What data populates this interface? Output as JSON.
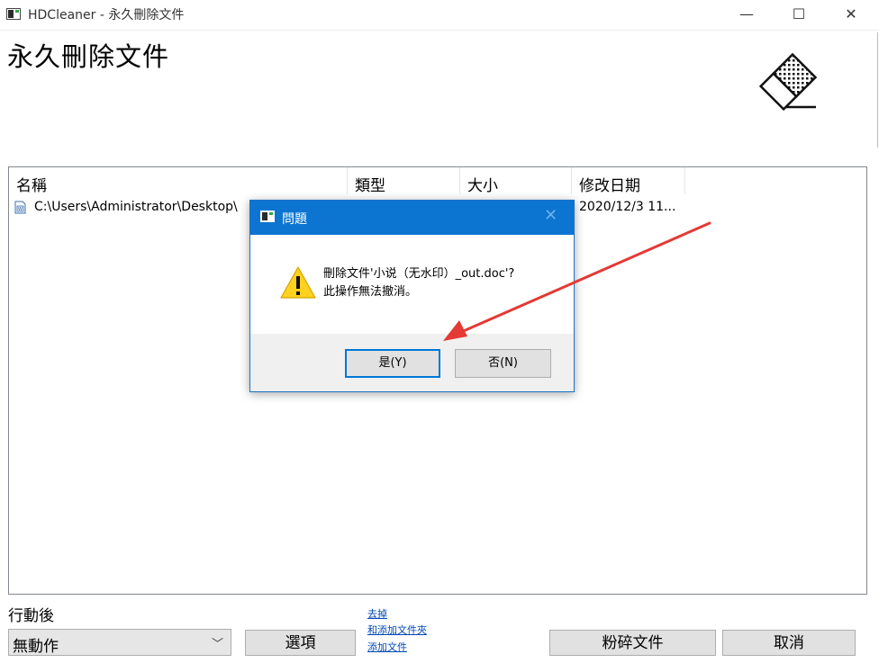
{
  "window": {
    "title": "HDCleaner - 永久刪除文件",
    "minimize_glyph": "—",
    "maximize_glyph": "☐",
    "close_glyph": "✕"
  },
  "page": {
    "heading": "永久刪除文件",
    "illustration_icon": "eraser-icon"
  },
  "file_list": {
    "columns": [
      "名稱",
      "類型",
      "大小",
      "修改日期"
    ],
    "rows": [
      {
        "name": "C:\\Users\\Administrator\\Desktop\\",
        "type": "",
        "size": "",
        "modified": "2020/12/3 11...",
        "icon": "document-icon"
      }
    ]
  },
  "bottom": {
    "after_action_label": "行動後",
    "after_action_value": "無動作",
    "options_button": "選項",
    "links": [
      "去掉",
      "和添加文件夾",
      "添加文件"
    ],
    "shred_button": "粉碎文件",
    "cancel_button": "取消"
  },
  "dialog": {
    "title": "問題",
    "message_line1": "刪除文件'小说（无水印）_out.doc'?",
    "message_line2": "此操作無法撤消。",
    "yes_button": "是(Y)",
    "no_button": "否(N)",
    "icon": "warning-icon"
  },
  "colors": {
    "dialog_titlebar": "#0b75d1",
    "annotation_arrow": "#e53935",
    "link": "#0047b3"
  }
}
